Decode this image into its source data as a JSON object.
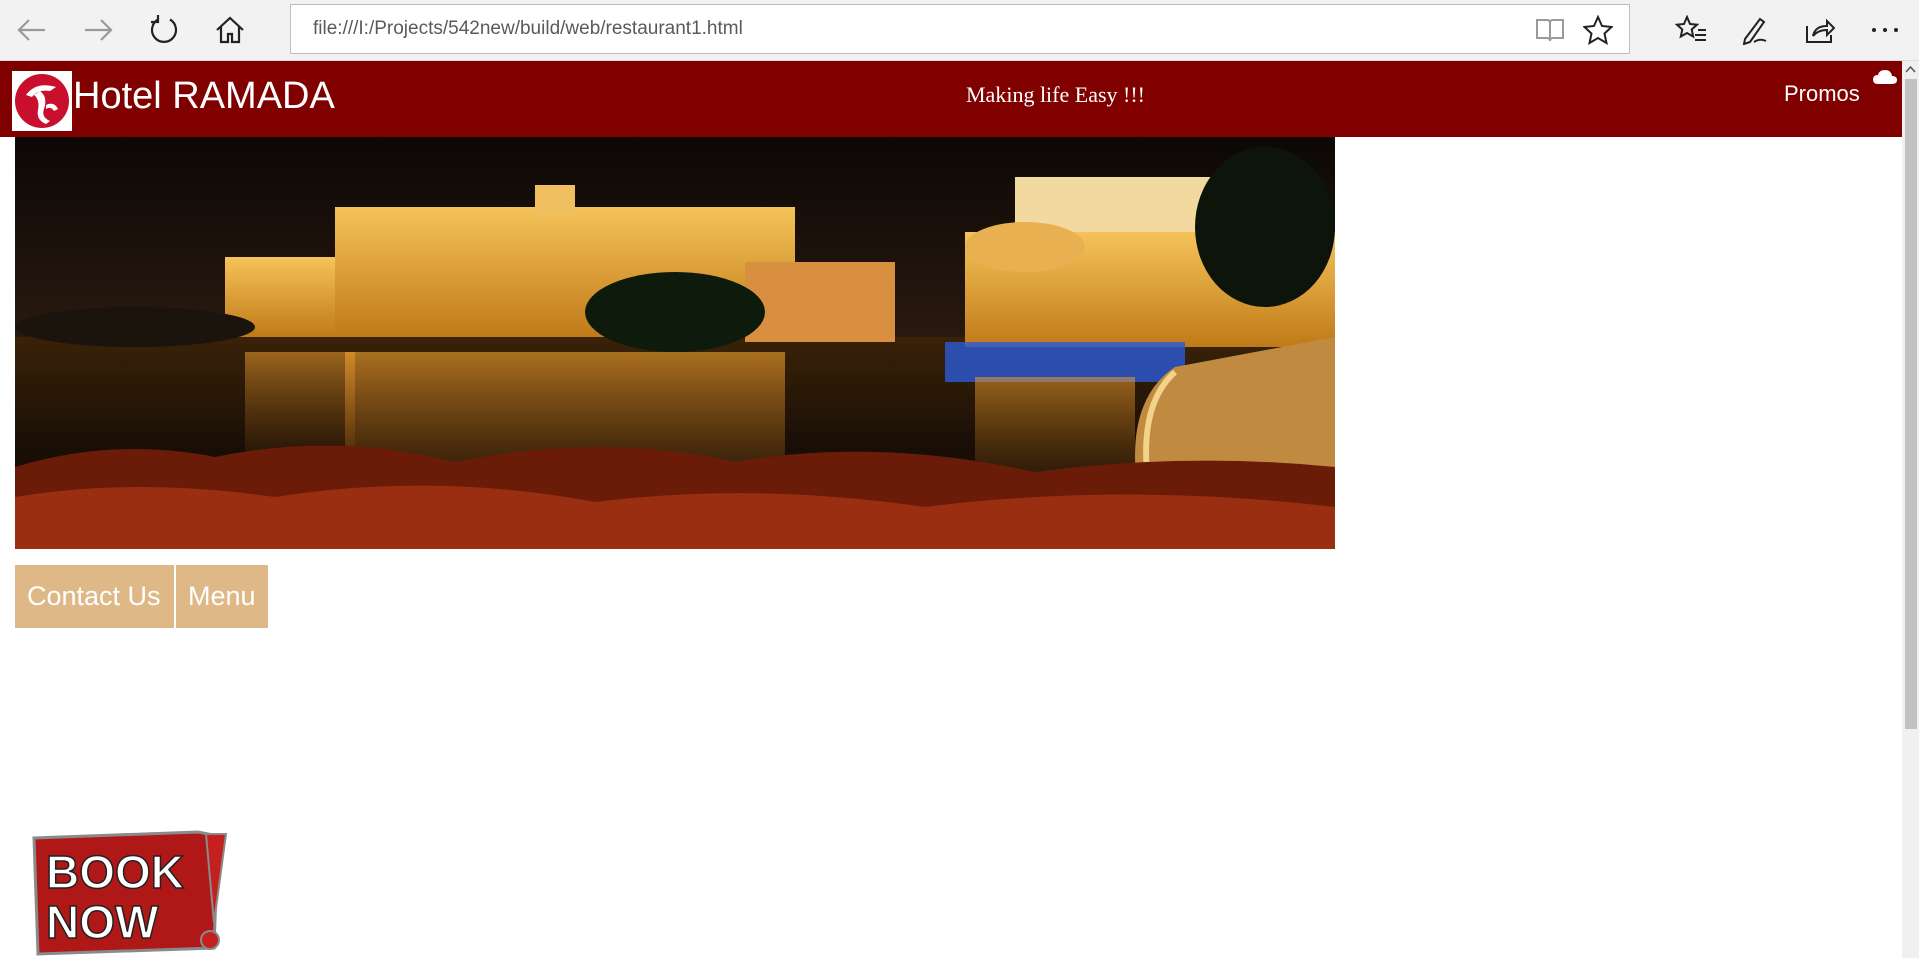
{
  "browser": {
    "url": "file:///I:/Projects/542new/build/web/restaurant1.html",
    "icons": [
      "back-arrow-icon",
      "forward-arrow-icon",
      "refresh-icon",
      "home-icon",
      "reading-view-icon",
      "favorite-star-icon",
      "favorites-list-icon",
      "pen-icon",
      "share-icon",
      "more-icon"
    ]
  },
  "header": {
    "brand": "Hotel RAMADA",
    "tagline": "Making life Easy !!!",
    "promos": "Promos",
    "background_color": "#800000"
  },
  "nav": {
    "contact": "Contact Us",
    "menu": "Menu",
    "button_color": "#deb887"
  },
  "book_now": {
    "line1": "BOOK",
    "line2": "NOW"
  }
}
